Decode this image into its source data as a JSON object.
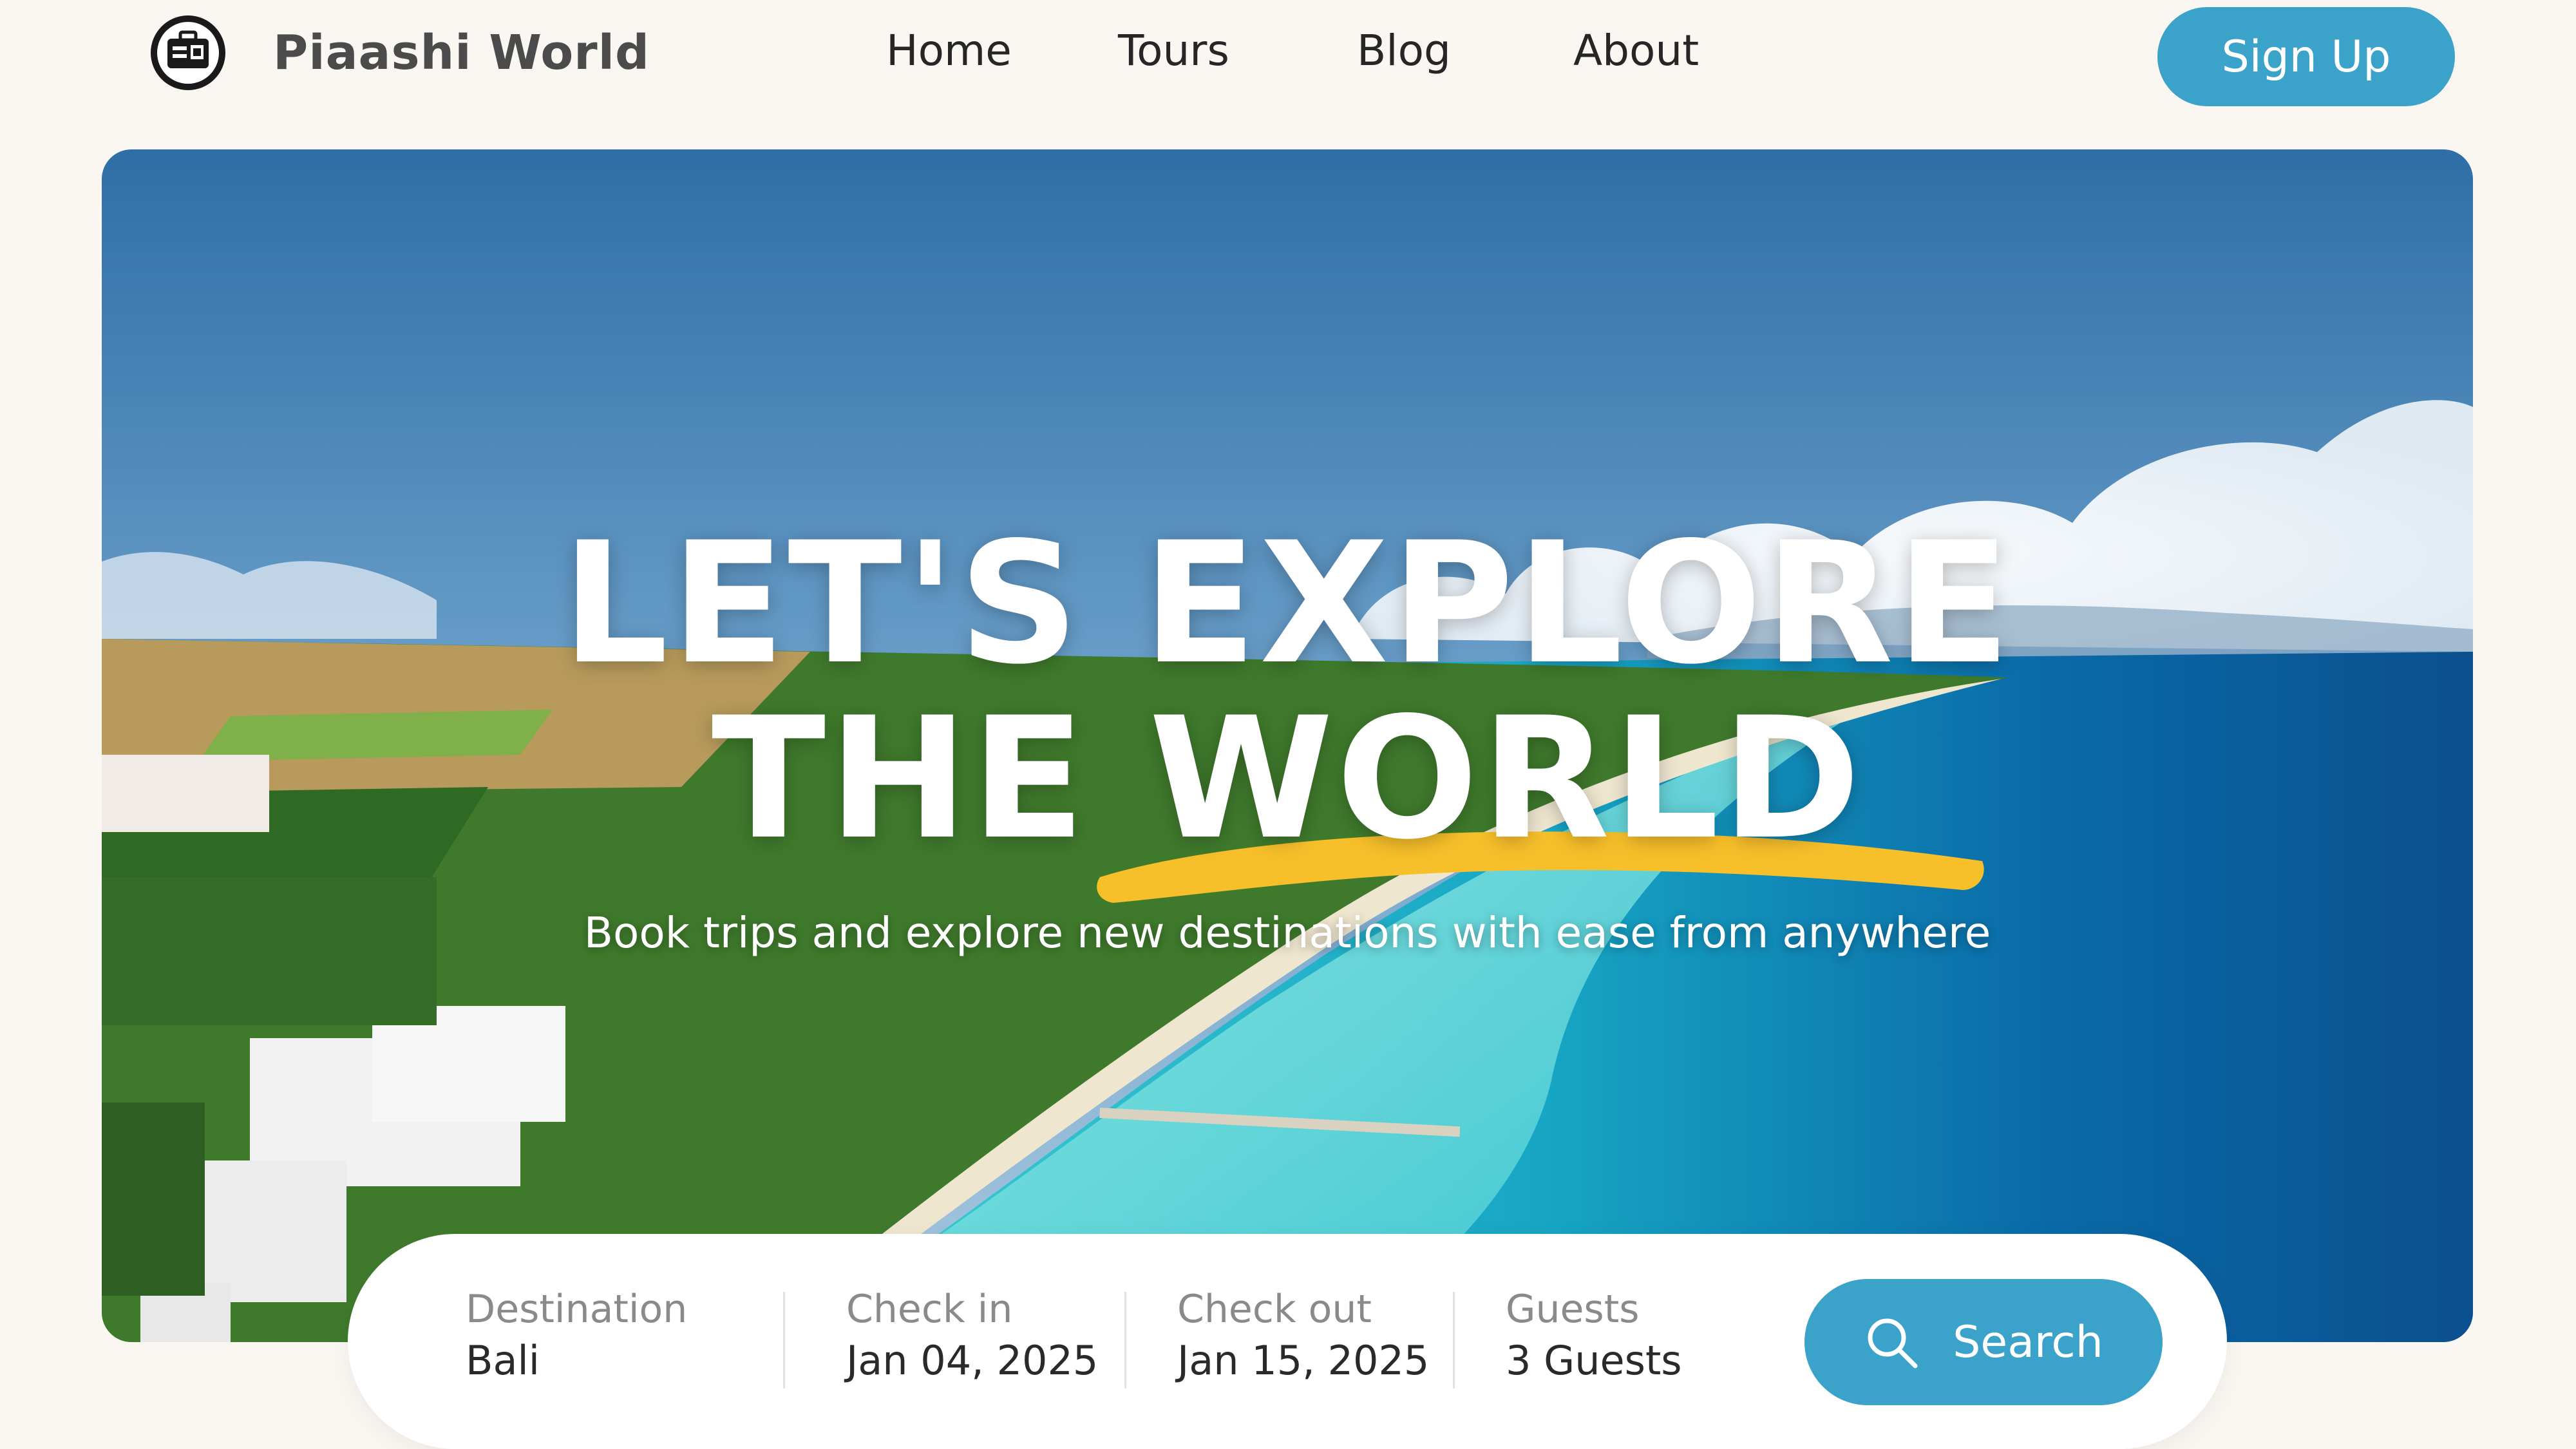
{
  "brand": {
    "name": "Piaashi World",
    "logo_icon": "globe-suitcase-icon"
  },
  "nav": {
    "items": [
      {
        "label": "Home"
      },
      {
        "label": "Tours"
      },
      {
        "label": "Blog"
      },
      {
        "label": "About"
      }
    ],
    "signup_label": "Sign Up"
  },
  "hero": {
    "title_line1": "LET'S EXPLORE",
    "title_line2": "THE WORLD",
    "subtitle": "Book trips and explore new destinations with ease from anywhere",
    "background": "aerial-coast-photo",
    "accent_color": "#f7bf2a"
  },
  "search": {
    "fields": [
      {
        "label": "Destination",
        "value": "Bali"
      },
      {
        "label": "Check in",
        "value": "Jan 04, 2025"
      },
      {
        "label": "Check out",
        "value": "Jan 15, 2025"
      },
      {
        "label": "Guests",
        "value": "3 Guests"
      }
    ],
    "button_label": "Search",
    "button_icon": "search-icon"
  },
  "colors": {
    "primary": "#3ba2c9",
    "page_bg": "#faf7f3",
    "text_dark": "#262626",
    "accent": "#f7bf2a"
  }
}
